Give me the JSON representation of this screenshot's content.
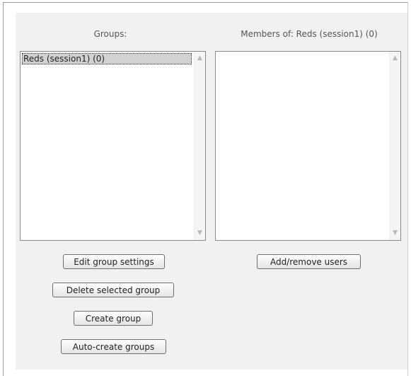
{
  "groups_column": {
    "label": "Groups:",
    "items": [
      "Reds (session1) (0)"
    ]
  },
  "members_column": {
    "label": "Members of: Reds (session1) (0)",
    "items": []
  },
  "buttons": {
    "edit_group_settings": "Edit group settings",
    "delete_selected_group": "Delete selected group",
    "create_group": "Create group",
    "auto_create_groups": "Auto-create groups",
    "add_remove_users": "Add/remove users"
  },
  "icons": {
    "scroll_up": "chevron-up-icon",
    "scroll_down": "chevron-down-icon"
  }
}
